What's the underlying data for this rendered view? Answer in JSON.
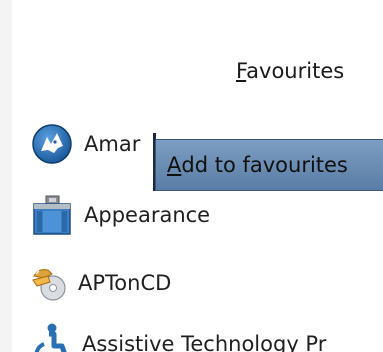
{
  "header": {
    "favourites_mnemonic": "F",
    "favourites_rest": "avourites"
  },
  "tooltip": {
    "mnemonic": "A",
    "rest": "dd to favourites"
  },
  "apps": [
    {
      "label": "Amar",
      "icon": "amarok-wolf-icon"
    },
    {
      "label": "Appearance",
      "icon": "appearance-icon"
    },
    {
      "label": "APTonCD",
      "icon": "aptoncd-icon"
    },
    {
      "label": "Assistive Technology Pr",
      "icon": "accessibility-icon"
    }
  ],
  "colors": {
    "tooltip_bg": "#6b8db5",
    "icon_blue": "#2a6fb3"
  }
}
